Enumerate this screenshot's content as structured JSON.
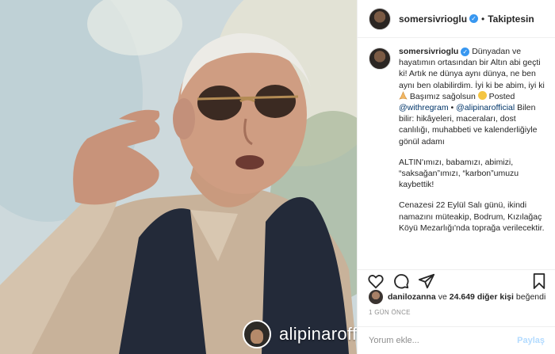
{
  "post": {
    "username": "somersivrioglu",
    "follow_label": "Takiptesin",
    "dot": "•",
    "caption": {
      "username": "somersivrioglu",
      "p1_a": "Dünyadan ve hayatımın ortasından bir Altın abi geçti ki! Artık ne dünya aynı dünya, ne ben aynı ben olabilirdim. İyi ki be abim, iyi ki",
      "p1_b": "Başımız sağolsun",
      "p1_c": "Posted",
      "mention1": "@withregram",
      "p1_d": "•",
      "mention2": "@alipinarofficial",
      "p1_e": "Bilen bilir: hikâyeleri, maceraları, dost canlılığı, muhabbeti ve kalenderliğiyle gönül adamı",
      "p2": "ALTIN'ımızı, babamızı, abimizi, “saksağan”ımızı, “karbon”umuzu kaybettik!",
      "p3": "Cenazesi 22 Eylül Salı günü, ikindi namazını müteakip, Bodrum, Kızılağaç Köyü Mezarlığı'nda toprağa verilecektir."
    },
    "likes": {
      "user": "danilozanna",
      "connector": "ve",
      "count": "24.649 diğer kişi",
      "suffix": "beğendi"
    },
    "time": "1 GÜN ÖNCE",
    "comment_placeholder": "Yorum ekle...",
    "post_label": "Paylaş"
  },
  "photo": {
    "watermark": "alipinaroffi"
  },
  "colors": {
    "verified": "#3897f0",
    "link": "#003569",
    "post_button": "#b3dbff"
  },
  "icons": [
    "heart-icon",
    "comment-icon",
    "share-icon",
    "bookmark-icon",
    "verified-icon"
  ]
}
